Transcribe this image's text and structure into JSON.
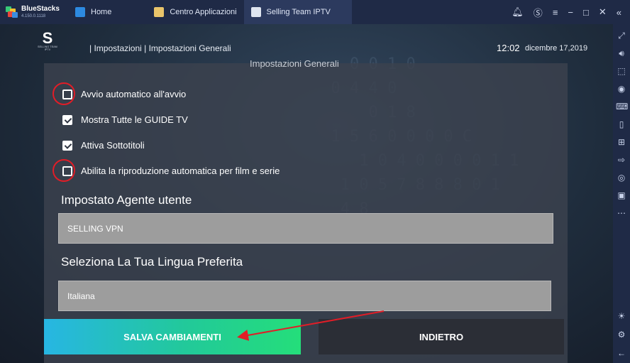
{
  "window": {
    "brand": "BlueStacks",
    "version": "4.150.0.1118",
    "tabs": [
      {
        "label": "Home",
        "icon": "home-icon"
      },
      {
        "label": "Centro Applicazioni",
        "icon": "app-center-icon"
      },
      {
        "label": "Selling Team IPTV",
        "icon": "iptv-app-icon"
      }
    ],
    "active_tab": 2,
    "controls": [
      "bell-icon",
      "account-icon",
      "menu-icon",
      "minimize-icon",
      "maximize-icon",
      "close-icon",
      "collapse-sidebar-icon"
    ]
  },
  "sidebar": {
    "tools": [
      "fullscreen-icon",
      "volume-icon",
      "screenshot-region-icon",
      "eye-icon",
      "keyboard-icon",
      "device-icon",
      "gamepad-icon",
      "install-apk-icon",
      "camera-icon",
      "record-icon",
      "more-icon"
    ],
    "bottom": [
      "brightness-icon",
      "settings-icon",
      "back-icon"
    ]
  },
  "app": {
    "logo_text": "SELLING TEAM",
    "logo_sub": "IPTV",
    "breadcrumb": "| Impostazioni | Impostazioni Generali",
    "time": "12:02",
    "date": "dicembre 17,2019",
    "panel_title": "Impostazioni Generali",
    "options": [
      {
        "label": "Avvio automatico all'avvio",
        "checked": false,
        "highlighted": true
      },
      {
        "label": "Mostra Tutte le GUIDE TV",
        "checked": true,
        "highlighted": false
      },
      {
        "label": "Attiva Sottotitoli",
        "checked": true,
        "highlighted": false
      },
      {
        "label": "Abilita la riproduzione automatica per film e serie",
        "checked": false,
        "highlighted": true
      }
    ],
    "user_agent_label": "Impostato Agente utente",
    "user_agent_value": "SELLING VPN",
    "language_label": "Seleziona La Tua Lingua Preferita",
    "language_value": "Italiana",
    "save_label": "SALVA CAMBIAMENTI",
    "back_label": "INDIETRO"
  },
  "colors": {
    "highlight_ring": "#e11d27",
    "save_gradient_start": "#27b6e3",
    "save_gradient_end": "#24de7a"
  }
}
